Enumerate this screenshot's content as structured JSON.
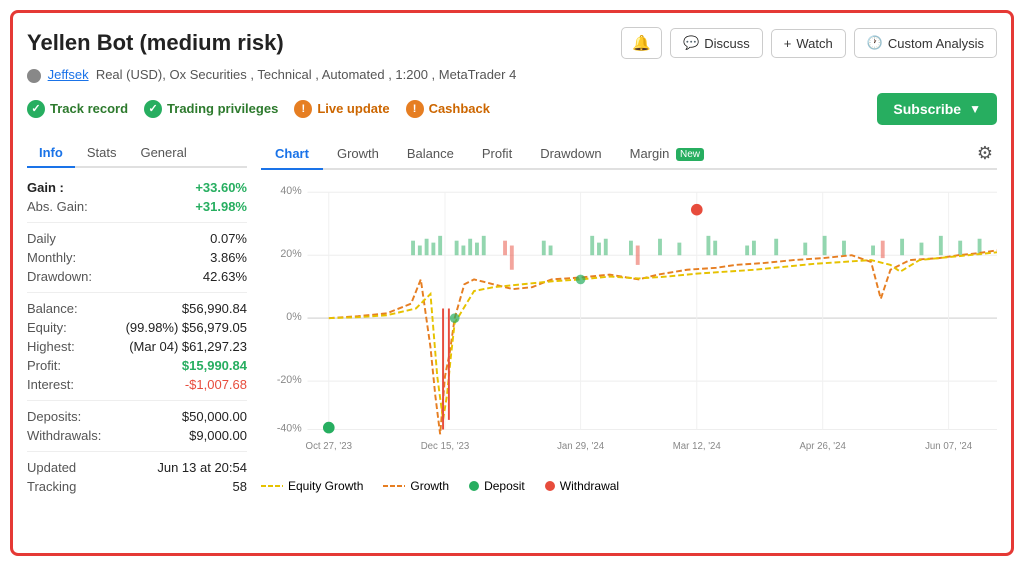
{
  "header": {
    "title": "Yellen Bot (medium risk)",
    "bell_label": "🔔",
    "discuss_label": "Discuss",
    "watch_label": "Watch",
    "custom_analysis_label": "Custom Analysis"
  },
  "subtitle": {
    "user": "Jeffsek",
    "details": "Real (USD), Ox Securities , Technical , Automated , 1:200 , MetaTrader 4"
  },
  "badges": [
    {
      "type": "check",
      "label": "Track record"
    },
    {
      "type": "check",
      "label": "Trading privileges"
    },
    {
      "type": "warn",
      "label": "Live update"
    },
    {
      "type": "warn",
      "label": "Cashback"
    }
  ],
  "subscribe_label": "Subscribe",
  "left_tabs": [
    {
      "label": "Info",
      "active": true
    },
    {
      "label": "Stats",
      "active": false
    },
    {
      "label": "General",
      "active": false
    }
  ],
  "stats": {
    "gain_label": "Gain :",
    "gain_value": "+33.60%",
    "abs_gain_label": "Abs. Gain:",
    "abs_gain_value": "+31.98%",
    "daily_label": "Daily",
    "daily_value": "0.07%",
    "monthly_label": "Monthly:",
    "monthly_value": "3.86%",
    "drawdown_label": "Drawdown:",
    "drawdown_value": "42.63%",
    "balance_label": "Balance:",
    "balance_value": "$56,990.84",
    "equity_label": "Equity:",
    "equity_value": "(99.98%) $56,979.05",
    "highest_label": "Highest:",
    "highest_value": "(Mar 04) $61,297.23",
    "profit_label": "Profit:",
    "profit_value": "$15,990.84",
    "interest_label": "Interest:",
    "interest_value": "-$1,007.68",
    "deposits_label": "Deposits:",
    "deposits_value": "$50,000.00",
    "withdrawals_label": "Withdrawals:",
    "withdrawals_value": "$9,000.00",
    "updated_label": "Updated",
    "updated_value": "Jun 13 at 20:54",
    "tracking_label": "Tracking",
    "tracking_value": "58"
  },
  "right_tabs": [
    {
      "label": "Chart",
      "active": true
    },
    {
      "label": "Growth",
      "active": false
    },
    {
      "label": "Balance",
      "active": false
    },
    {
      "label": "Profit",
      "active": false
    },
    {
      "label": "Drawdown",
      "active": false
    },
    {
      "label": "Margin",
      "active": false,
      "new": true
    }
  ],
  "chart": {
    "y_labels": [
      "40%",
      "20%",
      "0%",
      "-20%",
      "-40%"
    ],
    "x_labels": [
      "Oct 27, '23",
      "Dec 15, '23",
      "Jan 29, '24",
      "Mar 12, '24",
      "Apr 26, '24",
      "Jun 07, '24"
    ],
    "legend": [
      {
        "type": "dashed-yellow",
        "label": "Equity Growth"
      },
      {
        "type": "dashed-orange",
        "label": "Growth"
      },
      {
        "type": "dot-green",
        "label": "Deposit"
      },
      {
        "type": "dot-red",
        "label": "Withdrawal"
      }
    ]
  }
}
